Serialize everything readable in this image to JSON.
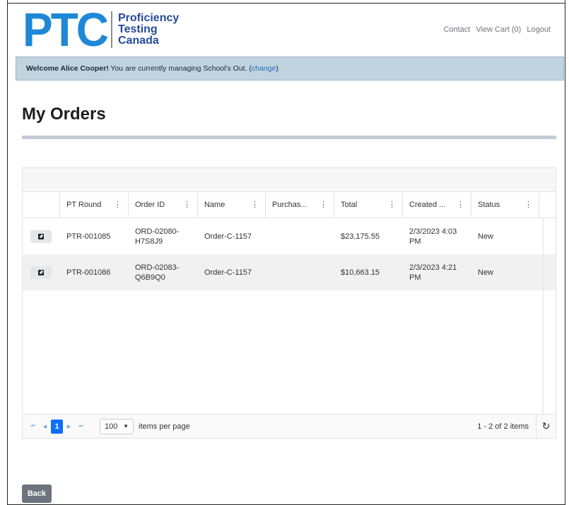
{
  "logo": {
    "mark": "PTC",
    "line1": "Proficiency",
    "line2": "Testing",
    "line3": "Canada"
  },
  "nav": {
    "contact": "Contact",
    "cart": "View Cart (0)",
    "logout": "Logout"
  },
  "welcome": {
    "greeting": "Welcome Alice Cooper!",
    "message": " You are currently managing School's Out. (",
    "change": "change",
    "close": ")"
  },
  "page": {
    "title": "My Orders"
  },
  "grid": {
    "columns": [
      "",
      "PT Round",
      "Order ID",
      "Name",
      "Purchas...",
      "Total",
      "Created ...",
      "Status"
    ],
    "rows": [
      {
        "pt_round": "PTR-001085",
        "order_id_1": "ORD-02080-",
        "order_id_2": "H7S8J9",
        "name": "Order-C-1157",
        "purchase": "",
        "total": "$23,175.55",
        "created_1": "2/3/2023 4:03",
        "created_2": "PM",
        "status": "New"
      },
      {
        "pt_round": "PTR-001086",
        "order_id_1": "ORD-02083-",
        "order_id_2": "Q6B9Q0",
        "name": "Order-C-1157",
        "purchase": "",
        "total": "$10,663.15",
        "created_1": "2/3/2023 4:21",
        "created_2": "PM",
        "status": "New"
      }
    ]
  },
  "pager": {
    "first": "⏮",
    "prev": "◀",
    "current": "1",
    "next": "▶",
    "last": "⏭",
    "page_size": "100",
    "items_per_page": "items per page",
    "range": "1 - 2 of 2 items",
    "refresh": "↻"
  },
  "actions": {
    "back": "Back"
  },
  "icons": {
    "edit": "edit-icon",
    "kebab": "column-menu-icon",
    "refresh": "refresh-icon"
  },
  "colors": {
    "brand_blue": "#1e88d6",
    "brand_navy": "#244a9c",
    "welcome_bg": "#c1d3df",
    "pager_active": "#0d6efd",
    "back_button": "#6c757d"
  }
}
